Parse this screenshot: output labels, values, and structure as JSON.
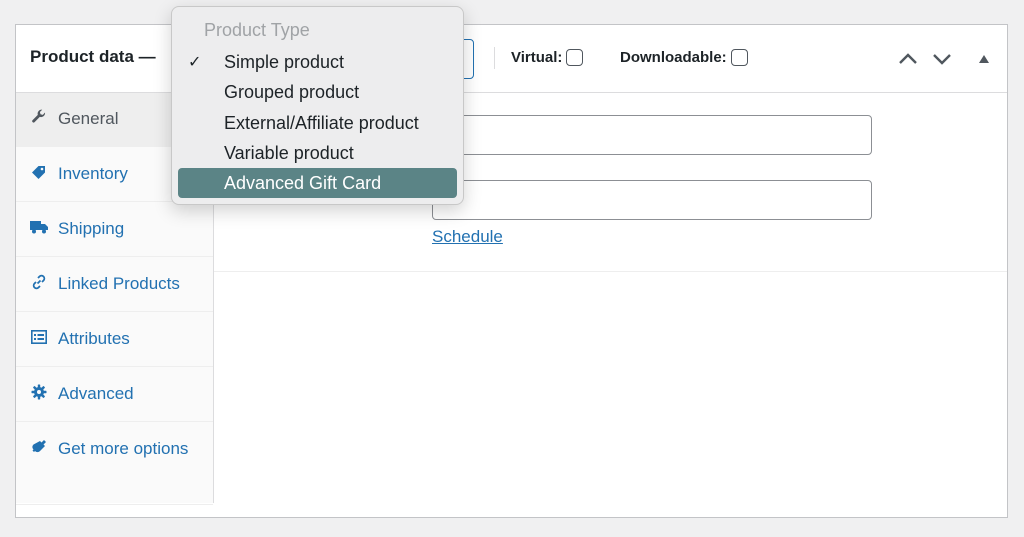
{
  "panel": {
    "title": "Product data —",
    "virtual_label": "Virtual:",
    "downloadable_label": "Downloadable:"
  },
  "tabs": [
    {
      "label": "General",
      "icon": "wrench-icon",
      "active": true
    },
    {
      "label": "Inventory",
      "icon": "tag-icon",
      "active": false
    },
    {
      "label": "Shipping",
      "icon": "truck-icon",
      "active": false
    },
    {
      "label": "Linked Products",
      "icon": "link-icon",
      "active": false
    },
    {
      "label": "Attributes",
      "icon": "list-icon",
      "active": false
    },
    {
      "label": "Advanced",
      "icon": "gear-icon",
      "active": false
    },
    {
      "label": "Get more options",
      "icon": "plug-icon",
      "active": false
    }
  ],
  "general": {
    "schedule_link": "Schedule"
  },
  "dropdown": {
    "header": "Product Type",
    "items": [
      {
        "label": "Simple product",
        "checked": true
      },
      {
        "label": "Grouped product",
        "checked": false
      },
      {
        "label": "External/Affiliate product",
        "checked": false
      },
      {
        "label": "Variable product",
        "checked": false
      },
      {
        "label": "Advanced Gift Card",
        "checked": false,
        "highlighted": true
      }
    ],
    "check_glyph": "✓"
  },
  "colors": {
    "link": "#2271b1",
    "highlight": "#5b8486"
  }
}
